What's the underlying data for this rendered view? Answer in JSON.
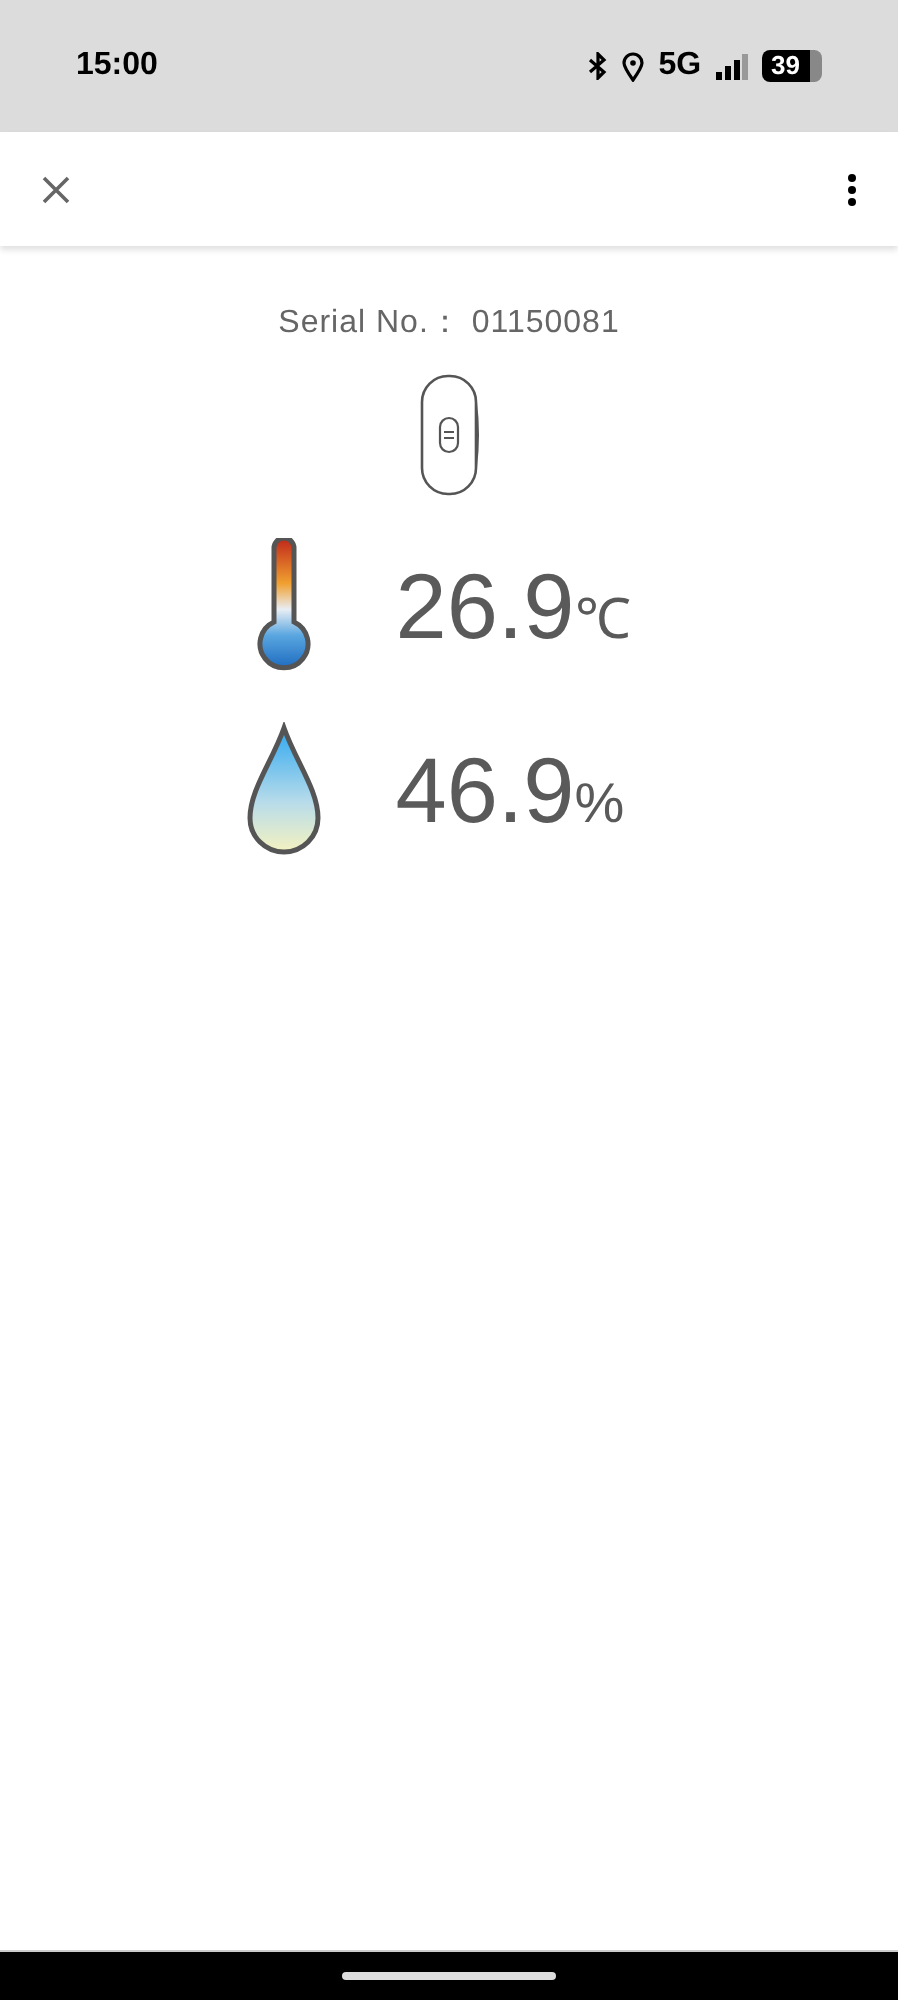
{
  "status_bar": {
    "time": "15:00",
    "network": "5G",
    "battery": "39"
  },
  "serial": {
    "label": "Serial No.：",
    "value": "01150081"
  },
  "readings": [
    {
      "kind": "temperature",
      "value": "26.9",
      "unit": "℃"
    },
    {
      "kind": "humidity",
      "value": "46.9",
      "unit": "%"
    }
  ]
}
